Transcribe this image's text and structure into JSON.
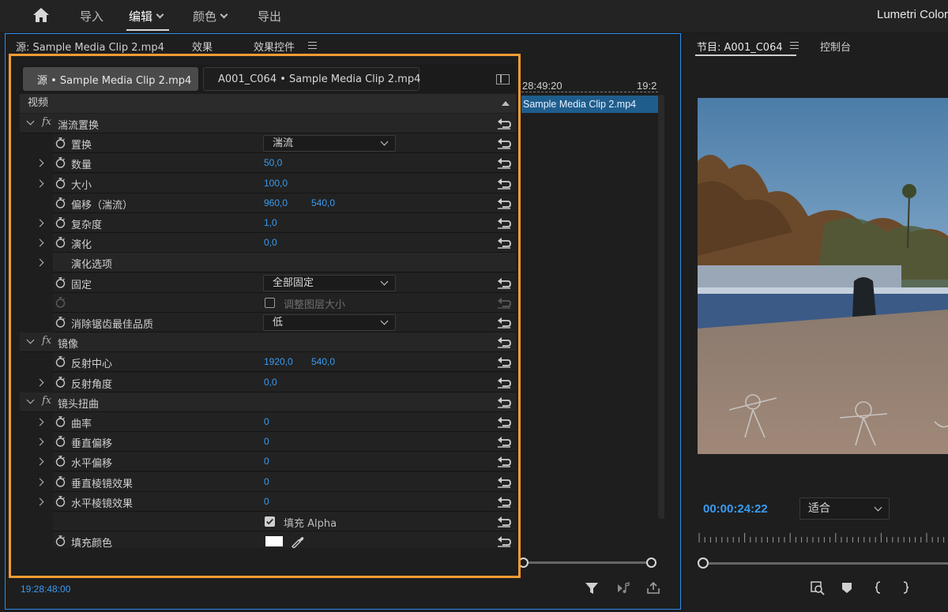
{
  "topbar": {
    "menu": [
      {
        "label": "导入",
        "active": false
      },
      {
        "label": "编辑",
        "active": true
      },
      {
        "label": "颜色",
        "active": false
      },
      {
        "label": "导出",
        "active": false
      }
    ],
    "right_title": "Lumetri Color"
  },
  "source_panel": {
    "tabs": [
      "源: Sample Media Clip 2.mp4",
      "效果",
      "效果控件"
    ],
    "timecode": "19:28:48:00"
  },
  "effect_controls": {
    "tab_source": "源 • Sample Media Clip 2.mp4",
    "tab_clip": "A001_C064 • Sample Media Clip 2.mp4",
    "section_label": "视频",
    "rows": [
      {
        "kind": "effect",
        "label": "湍流置换"
      },
      {
        "kind": "prop",
        "label": "置换",
        "dropdown": "湍流",
        "expand": false
      },
      {
        "kind": "prop",
        "label": "数量",
        "v1": "50,0",
        "expand": true
      },
      {
        "kind": "prop",
        "label": "大小",
        "v1": "100,0",
        "expand": true
      },
      {
        "kind": "prop",
        "label": "偏移（湍流）",
        "v1": "960,0",
        "v2": "540,0",
        "expand": false
      },
      {
        "kind": "prop",
        "label": "复杂度",
        "v1": "1,0",
        "expand": true
      },
      {
        "kind": "prop",
        "label": "演化",
        "v1": "0,0",
        "expand": true
      },
      {
        "kind": "group",
        "label": "演化选项",
        "expand": true,
        "noreset": true
      },
      {
        "kind": "prop",
        "label": "固定",
        "dropdown": "全部固定",
        "expand": false
      },
      {
        "kind": "prop",
        "label": "",
        "checkbox": "调整图层大小",
        "checked": false,
        "disabled": true,
        "expand": false
      },
      {
        "kind": "prop",
        "label": "消除锯齿最佳品质",
        "dropdown": "低",
        "expand": false
      },
      {
        "kind": "effect",
        "label": "镜像"
      },
      {
        "kind": "prop",
        "label": "反射中心",
        "v1": "1920,0",
        "v2": "540,0",
        "expand": false
      },
      {
        "kind": "prop",
        "label": "反射角度",
        "v1": "0,0",
        "expand": true
      },
      {
        "kind": "effect",
        "label": "镜头扭曲"
      },
      {
        "kind": "prop",
        "label": "曲率",
        "v1": "0",
        "expand": true
      },
      {
        "kind": "prop",
        "label": "垂直偏移",
        "v1": "0",
        "expand": true
      },
      {
        "kind": "prop",
        "label": "水平偏移",
        "v1": "0",
        "expand": true
      },
      {
        "kind": "prop",
        "label": "垂直棱镜效果",
        "v1": "0",
        "expand": true
      },
      {
        "kind": "prop",
        "label": "水平棱镜效果",
        "v1": "0",
        "expand": true
      },
      {
        "kind": "prop",
        "label": "",
        "checkbox": "填充 Alpha",
        "checked": true,
        "nostopwatch": true,
        "expand": false
      },
      {
        "kind": "prop",
        "label": "填充颜色",
        "color": "#ffffff",
        "expand": false
      }
    ]
  },
  "timeline": {
    "ruler_time": "28:49:20",
    "ruler_time_cut": "19:2",
    "clip_name": "Sample Media Clip 2.mp4"
  },
  "program": {
    "tab": "节目: A001_C064",
    "tab2": "控制台",
    "timecode": "00:00:24:22",
    "fit": "适合"
  },
  "colors": {
    "accent_blue": "#3a9bf1",
    "highlight_orange": "#f39c33",
    "clip_blue": "#1f5d8c"
  }
}
